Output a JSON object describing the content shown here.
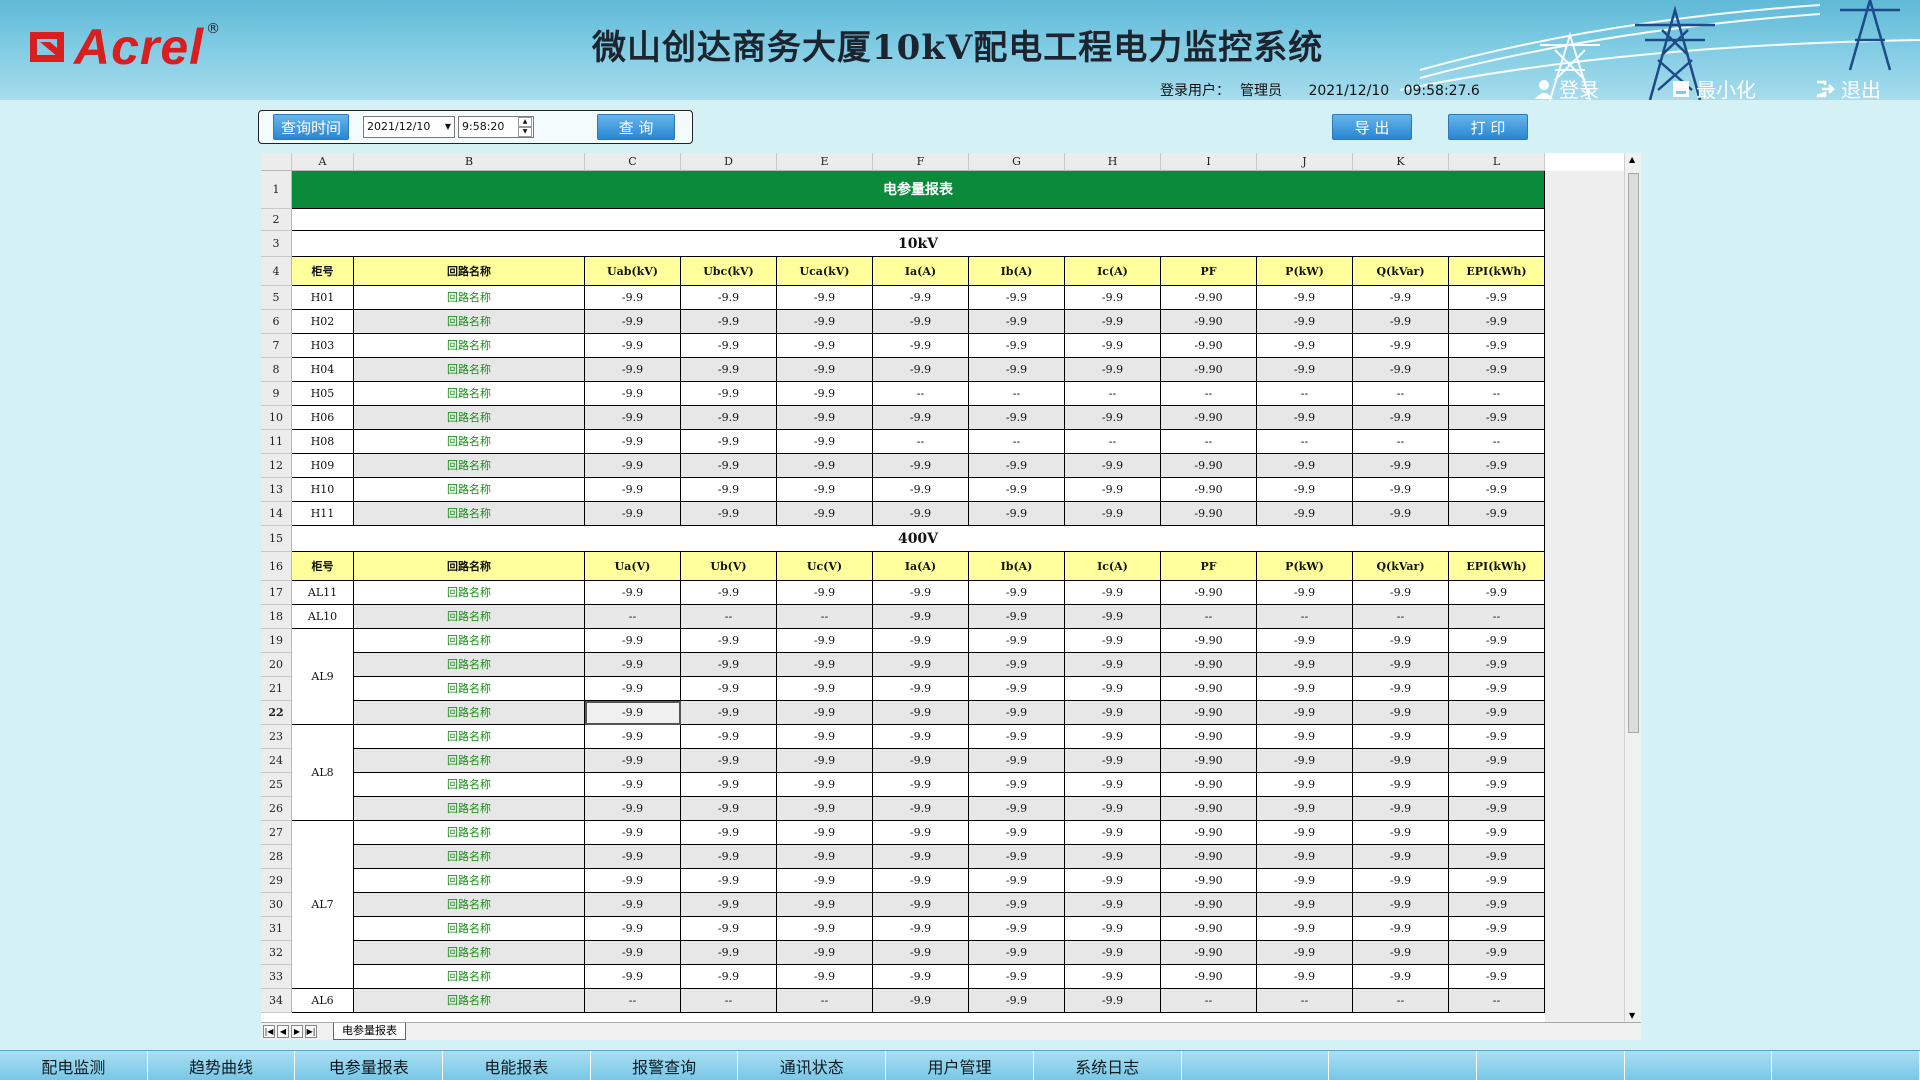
{
  "header": {
    "logo_text": "Acrel",
    "logo_reg": "®",
    "title": "微山创达商务大厦10kV配电工程电力监控系统",
    "user_label": "登录用户：",
    "user_name": "管理员",
    "date": "2021/12/10",
    "time": "09:58:27.6",
    "login_label": "登录",
    "minimize_label": "最小化",
    "exit_label": "退出"
  },
  "query": {
    "time_button": "查询时间",
    "date_value": "2021/12/10",
    "time_value": "9:58:20",
    "query_button": "查 询",
    "export_button": "导 出",
    "print_button": "打 印"
  },
  "sheet": {
    "columns": [
      "A",
      "B",
      "C",
      "D",
      "E",
      "F",
      "G",
      "H",
      "I",
      "J",
      "K",
      "L"
    ],
    "title": "电参量报表",
    "section_10kv": "10kV",
    "section_400v": "400V",
    "headers_10kv": [
      "柜号",
      "回路名称",
      "Uab(kV)",
      "Ubc(kV)",
      "Uca(kV)",
      "Ia(A)",
      "Ib(A)",
      "Ic(A)",
      "PF",
      "P(kW)",
      "Q(kVar)",
      "EPI(kWh)"
    ],
    "headers_400v": [
      "柜号",
      "回路名称",
      "Ua(V)",
      "Ub(V)",
      "Uc(V)",
      "Ia(A)",
      "Ib(A)",
      "Ic(A)",
      "PF",
      "P(kW)",
      "Q(kVar)",
      "EPI(kWh)"
    ],
    "rows_10kv": [
      [
        "H01",
        "回路名称",
        "-9.9",
        "-9.9",
        "-9.9",
        "-9.9",
        "-9.9",
        "-9.9",
        "-9.90",
        "-9.9",
        "-9.9",
        "-9.9"
      ],
      [
        "H02",
        "回路名称",
        "-9.9",
        "-9.9",
        "-9.9",
        "-9.9",
        "-9.9",
        "-9.9",
        "-9.90",
        "-9.9",
        "-9.9",
        "-9.9"
      ],
      [
        "H03",
        "回路名称",
        "-9.9",
        "-9.9",
        "-9.9",
        "-9.9",
        "-9.9",
        "-9.9",
        "-9.90",
        "-9.9",
        "-9.9",
        "-9.9"
      ],
      [
        "H04",
        "回路名称",
        "-9.9",
        "-9.9",
        "-9.9",
        "-9.9",
        "-9.9",
        "-9.9",
        "-9.90",
        "-9.9",
        "-9.9",
        "-9.9"
      ],
      [
        "H05",
        "回路名称",
        "-9.9",
        "-9.9",
        "-9.9",
        "--",
        "--",
        "--",
        "--",
        "--",
        "--",
        "--"
      ],
      [
        "H06",
        "回路名称",
        "-9.9",
        "-9.9",
        "-9.9",
        "-9.9",
        "-9.9",
        "-9.9",
        "-9.90",
        "-9.9",
        "-9.9",
        "-9.9"
      ],
      [
        "H08",
        "回路名称",
        "-9.9",
        "-9.9",
        "-9.9",
        "--",
        "--",
        "--",
        "--",
        "--",
        "--",
        "--"
      ],
      [
        "H09",
        "回路名称",
        "-9.9",
        "-9.9",
        "-9.9",
        "-9.9",
        "-9.9",
        "-9.9",
        "-9.90",
        "-9.9",
        "-9.9",
        "-9.9"
      ],
      [
        "H10",
        "回路名称",
        "-9.9",
        "-9.9",
        "-9.9",
        "-9.9",
        "-9.9",
        "-9.9",
        "-9.90",
        "-9.9",
        "-9.9",
        "-9.9"
      ],
      [
        "H11",
        "回路名称",
        "-9.9",
        "-9.9",
        "-9.9",
        "-9.9",
        "-9.9",
        "-9.9",
        "-9.90",
        "-9.9",
        "-9.9",
        "-9.9"
      ]
    ],
    "rows_400v": [
      [
        "AL11",
        "回路名称",
        "-9.9",
        "-9.9",
        "-9.9",
        "-9.9",
        "-9.9",
        "-9.9",
        "-9.90",
        "-9.9",
        "-9.9",
        "-9.9"
      ],
      [
        "AL10",
        "回路名称",
        "--",
        "--",
        "--",
        "-9.9",
        "-9.9",
        "-9.9",
        "--",
        "--",
        "--",
        "--"
      ],
      [
        "AL9",
        "回路名称",
        "-9.9",
        "-9.9",
        "-9.9",
        "-9.9",
        "-9.9",
        "-9.9",
        "-9.90",
        "-9.9",
        "-9.9",
        "-9.9"
      ],
      [
        "",
        "回路名称",
        "-9.9",
        "-9.9",
        "-9.9",
        "-9.9",
        "-9.9",
        "-9.9",
        "-9.90",
        "-9.9",
        "-9.9",
        "-9.9"
      ],
      [
        "",
        "回路名称",
        "-9.9",
        "-9.9",
        "-9.9",
        "-9.9",
        "-9.9",
        "-9.9",
        "-9.90",
        "-9.9",
        "-9.9",
        "-9.9"
      ],
      [
        "",
        "回路名称",
        "-9.9",
        "-9.9",
        "-9.9",
        "-9.9",
        "-9.9",
        "-9.9",
        "-9.90",
        "-9.9",
        "-9.9",
        "-9.9"
      ],
      [
        "AL8",
        "回路名称",
        "-9.9",
        "-9.9",
        "-9.9",
        "-9.9",
        "-9.9",
        "-9.9",
        "-9.90",
        "-9.9",
        "-9.9",
        "-9.9"
      ],
      [
        "",
        "回路名称",
        "-9.9",
        "-9.9",
        "-9.9",
        "-9.9",
        "-9.9",
        "-9.9",
        "-9.90",
        "-9.9",
        "-9.9",
        "-9.9"
      ],
      [
        "",
        "回路名称",
        "-9.9",
        "-9.9",
        "-9.9",
        "-9.9",
        "-9.9",
        "-9.9",
        "-9.90",
        "-9.9",
        "-9.9",
        "-9.9"
      ],
      [
        "",
        "回路名称",
        "-9.9",
        "-9.9",
        "-9.9",
        "-9.9",
        "-9.9",
        "-9.9",
        "-9.90",
        "-9.9",
        "-9.9",
        "-9.9"
      ],
      [
        "AL7",
        "回路名称",
        "-9.9",
        "-9.9",
        "-9.9",
        "-9.9",
        "-9.9",
        "-9.9",
        "-9.90",
        "-9.9",
        "-9.9",
        "-9.9"
      ],
      [
        "",
        "回路名称",
        "-9.9",
        "-9.9",
        "-9.9",
        "-9.9",
        "-9.9",
        "-9.9",
        "-9.90",
        "-9.9",
        "-9.9",
        "-9.9"
      ],
      [
        "",
        "回路名称",
        "-9.9",
        "-9.9",
        "-9.9",
        "-9.9",
        "-9.9",
        "-9.9",
        "-9.90",
        "-9.9",
        "-9.9",
        "-9.9"
      ],
      [
        "",
        "回路名称",
        "-9.9",
        "-9.9",
        "-9.9",
        "-9.9",
        "-9.9",
        "-9.9",
        "-9.90",
        "-9.9",
        "-9.9",
        "-9.9"
      ],
      [
        "",
        "回路名称",
        "-9.9",
        "-9.9",
        "-9.9",
        "-9.9",
        "-9.9",
        "-9.9",
        "-9.90",
        "-9.9",
        "-9.9",
        "-9.9"
      ],
      [
        "",
        "回路名称",
        "-9.9",
        "-9.9",
        "-9.9",
        "-9.9",
        "-9.9",
        "-9.9",
        "-9.90",
        "-9.9",
        "-9.9",
        "-9.9"
      ],
      [
        "",
        "回路名称",
        "-9.9",
        "-9.9",
        "-9.9",
        "-9.9",
        "-9.9",
        "-9.9",
        "-9.90",
        "-9.9",
        "-9.9",
        "-9.9"
      ],
      [
        "AL6",
        "回路名称",
        "--",
        "--",
        "--",
        "-9.9",
        "-9.9",
        "-9.9",
        "--",
        "--",
        "--",
        "--"
      ]
    ],
    "tab_name": "电参量报表"
  },
  "nav": [
    "配电监测",
    "趋势曲线",
    "电参量报表",
    "电能报表",
    "报警查询",
    "通讯状态",
    "用户管理",
    "系统日志",
    "",
    "",
    "",
    "",
    ""
  ],
  "colors": {
    "title_bar": "#0a8a3a",
    "header_row": "#ffff9b",
    "loop_name": "#1a8d1a",
    "logo_red": "#d81e1e"
  }
}
